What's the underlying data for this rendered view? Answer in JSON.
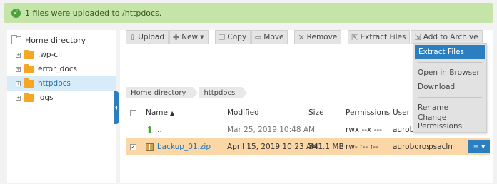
{
  "notification": {
    "message": "1 files were uploaded to /httpdocs."
  },
  "sidebar": {
    "root": "Home directory",
    "items": [
      {
        "label": ".wp-cli",
        "selected": false
      },
      {
        "label": "error_docs",
        "selected": false
      },
      {
        "label": "httpdocs",
        "selected": true
      },
      {
        "label": "logs",
        "selected": false
      }
    ]
  },
  "toolbar": {
    "upload": "Upload",
    "new": "New",
    "copy": "Copy",
    "move": "Move",
    "remove": "Remove",
    "extract": "Extract Files",
    "add_archive": "Add to Archive"
  },
  "breadcrumb": [
    "Home directory",
    "httpdocs"
  ],
  "table": {
    "headers": {
      "name": "Name",
      "modified": "Modified",
      "size": "Size",
      "permissions": "Permissions",
      "user": "User"
    },
    "rows": [
      {
        "name": "..",
        "modified": "Mar 25, 2019 10:48 AM",
        "size": "",
        "permissions": "rwx --x ---",
        "user": "aurobo",
        "group": "",
        "selected": false
      },
      {
        "name": "backup_01.zip",
        "modified": "April 15, 2019 10:23 AM",
        "size": "341.1 MB",
        "permissions": "rw- r-- r--",
        "user": "auroboros",
        "group": "psacln",
        "selected": true
      }
    ]
  },
  "context_menu": {
    "items": [
      "Extract Files",
      "Open in Browser",
      "Download",
      "Rename",
      "Change Permissions"
    ]
  },
  "colors": {
    "accent": "#2b7fc1",
    "selected_row": "#fbd6a6",
    "notice_bg": "#c4e4a8"
  }
}
